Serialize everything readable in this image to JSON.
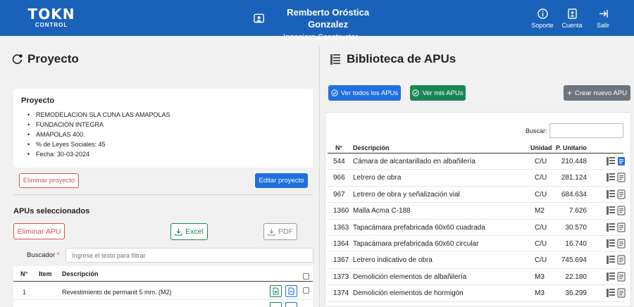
{
  "header": {
    "logo_line1": "TOKN",
    "logo_line2": "CONTROL",
    "user_name": "Remberto Oróstica Gonzalez",
    "user_role": "Ingeniero Constructor",
    "nav": [
      {
        "label": "Soporte",
        "icon": "info-icon"
      },
      {
        "label": "Cuenta",
        "icon": "account-icon"
      },
      {
        "label": "Salir",
        "icon": "logout-icon"
      }
    ]
  },
  "left": {
    "title": "Proyecto",
    "card_title": "Proyecto",
    "details": [
      "REMODELACION SLA CUNA LAS AMAPOLAS",
      "FUNDACION INTEGRA",
      "AMAPOLAS 400.",
      "% de Leyes Sociales: 45",
      "Fecha: 30-03-2024"
    ],
    "delete_project": "Eliminar proyecto",
    "edit_project": "Editar proyecto",
    "selected_title": "APUs seleccionados",
    "delete_apu": "Eliminar APU",
    "excel": "Excel",
    "pdf": "PDF",
    "search_label": "Buscador",
    "search_required": "*",
    "search_placeholder": "Ingrese el texto para filtrar",
    "table_headers": {
      "n": "N°",
      "item": "Item",
      "desc": "Descripción"
    },
    "rows": [
      {
        "n": "1",
        "desc": "Revestimiento de permanit 5 mm. (M2)"
      }
    ]
  },
  "right": {
    "title": "Biblioteca de APUs",
    "btn_all": "Ver todos los APUs",
    "btn_mine": "Ver mis APUs",
    "btn_create": "Crear nuevo APU",
    "search_label": "Buscar:",
    "headers": {
      "n": "N°",
      "desc": "Descripción",
      "unit": "Unidad",
      "price": "P. Unitario"
    },
    "rows": [
      {
        "n": "544",
        "desc": "Cámara de alcantarillado en albañilería",
        "unit": "C/U",
        "price": "210.448"
      },
      {
        "n": "966",
        "desc": "Letrero de obra",
        "unit": "C/U",
        "price": "281.124"
      },
      {
        "n": "967",
        "desc": "Letrero de obra y señalización vial",
        "unit": "C/U",
        "price": "684.634"
      },
      {
        "n": "1360",
        "desc": "Malla Acma C-188",
        "unit": "M2",
        "price": "7.626"
      },
      {
        "n": "1363",
        "desc": "Tapacámara prefabricada 60x60 cuadrada",
        "unit": "C/U",
        "price": "30.570"
      },
      {
        "n": "1364",
        "desc": "Tapacámara prefabricada 60x60 circular",
        "unit": "C/U",
        "price": "16.740"
      },
      {
        "n": "1367",
        "desc": "Letrero indicativo de obra",
        "unit": "C/U",
        "price": "745.694"
      },
      {
        "n": "1373",
        "desc": "Demolición elementos de albañilería",
        "unit": "M3",
        "price": "22.180"
      },
      {
        "n": "1374",
        "desc": "Demolición elementos de hormigón",
        "unit": "M3",
        "price": "36.299"
      }
    ]
  }
}
